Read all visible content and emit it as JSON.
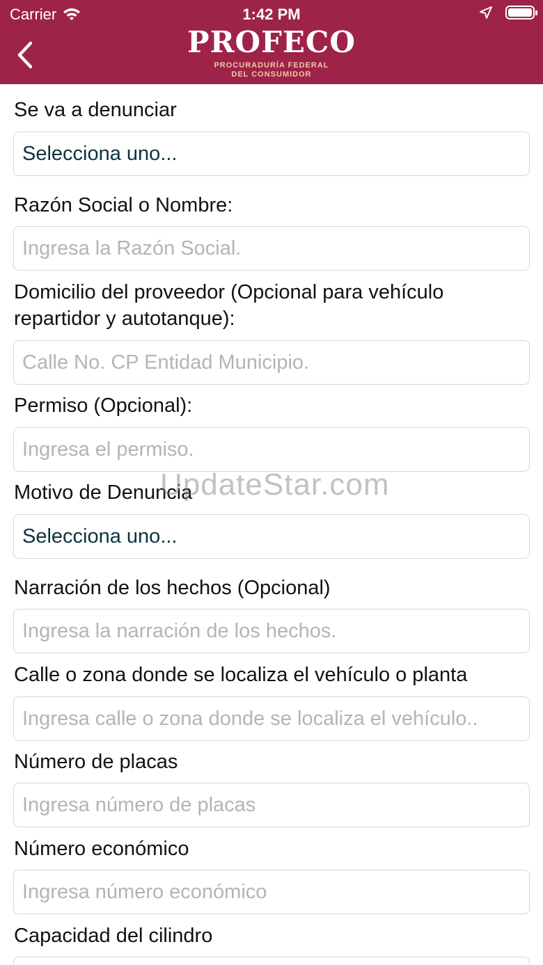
{
  "status_bar": {
    "carrier": "Carrier",
    "time": "1:42 PM"
  },
  "header": {
    "brand": "PROFECO",
    "subtitle_line1": "PROCURADURÍA FEDERAL",
    "subtitle_line2": "DEL CONSUMIDOR",
    "back_icon": "chevron-left-icon"
  },
  "colors": {
    "header_bg": "#9e2348",
    "select_text": "#0d3340",
    "placeholder": "#b4b4b4"
  },
  "form": {
    "fields": [
      {
        "label": "Se va a denunciar",
        "type": "select",
        "value": "Selecciona uno..."
      },
      {
        "label": "Razón Social o Nombre:",
        "type": "input",
        "placeholder": "Ingresa la Razón Social."
      },
      {
        "label_line1": "Domicilio del proveedor (Opcional para vehículo",
        "label_line2": "repartidor y autotanque):",
        "type": "input",
        "placeholder": "Calle No. CP Entidad Municipio."
      },
      {
        "label": "Permiso (Opcional):",
        "type": "input",
        "placeholder": "Ingresa el permiso."
      },
      {
        "label": "Motivo de Denuncia",
        "type": "select",
        "value": "Selecciona uno..."
      },
      {
        "label": "Narración de los hechos (Opcional)",
        "type": "input",
        "placeholder": "Ingresa la narración de los hechos."
      },
      {
        "label": "Calle o zona donde se localiza el vehículo o planta",
        "type": "input",
        "placeholder": "Ingresa calle o zona donde se localiza el vehículo.."
      },
      {
        "label": "Número de placas",
        "type": "input",
        "placeholder": "Ingresa número de placas"
      },
      {
        "label": "Número económico",
        "type": "input",
        "placeholder": "Ingresa número económico"
      },
      {
        "label": "Capacidad del cilindro",
        "type": "input",
        "placeholder": ""
      }
    ]
  },
  "watermark": "UpdateStar.com"
}
